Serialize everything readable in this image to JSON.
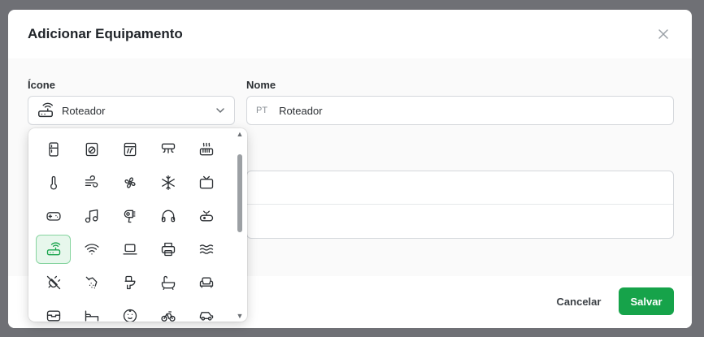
{
  "dialog": {
    "title": "Adicionar Equipamento"
  },
  "icon_field": {
    "label": "Ícone",
    "selected_label": "Roteador",
    "selected_icon": "router-icon"
  },
  "name_field": {
    "label": "Nome",
    "lang_prefix": "PT",
    "value": "Roteador"
  },
  "icon_options": [
    "fridge-icon",
    "washing-machine-icon",
    "oven-icon",
    "air-conditioner-icon",
    "heater-icon",
    "thermometer-icon",
    "wind-icon",
    "fan-icon",
    "snowflake-icon",
    "tv-icon",
    "gamepad-icon",
    "music-icon",
    "hair-dryer-icon",
    "headphones-icon",
    "robot-vacuum-icon",
    "router-icon",
    "wifi-icon",
    "laptop-icon",
    "printer-icon",
    "waves-icon",
    "plug-off-icon",
    "shower-icon",
    "toilet-icon",
    "bathtub-icon",
    "sofa-icon",
    "box-icon",
    "bed-icon",
    "baby-icon",
    "bicycle-icon",
    "car-icon"
  ],
  "selected_option": "router-icon",
  "footer": {
    "cancel_label": "Cancelar",
    "save_label": "Salvar"
  },
  "colors": {
    "primary": "#16a34a",
    "selected_bg": "#e7f7ec"
  }
}
